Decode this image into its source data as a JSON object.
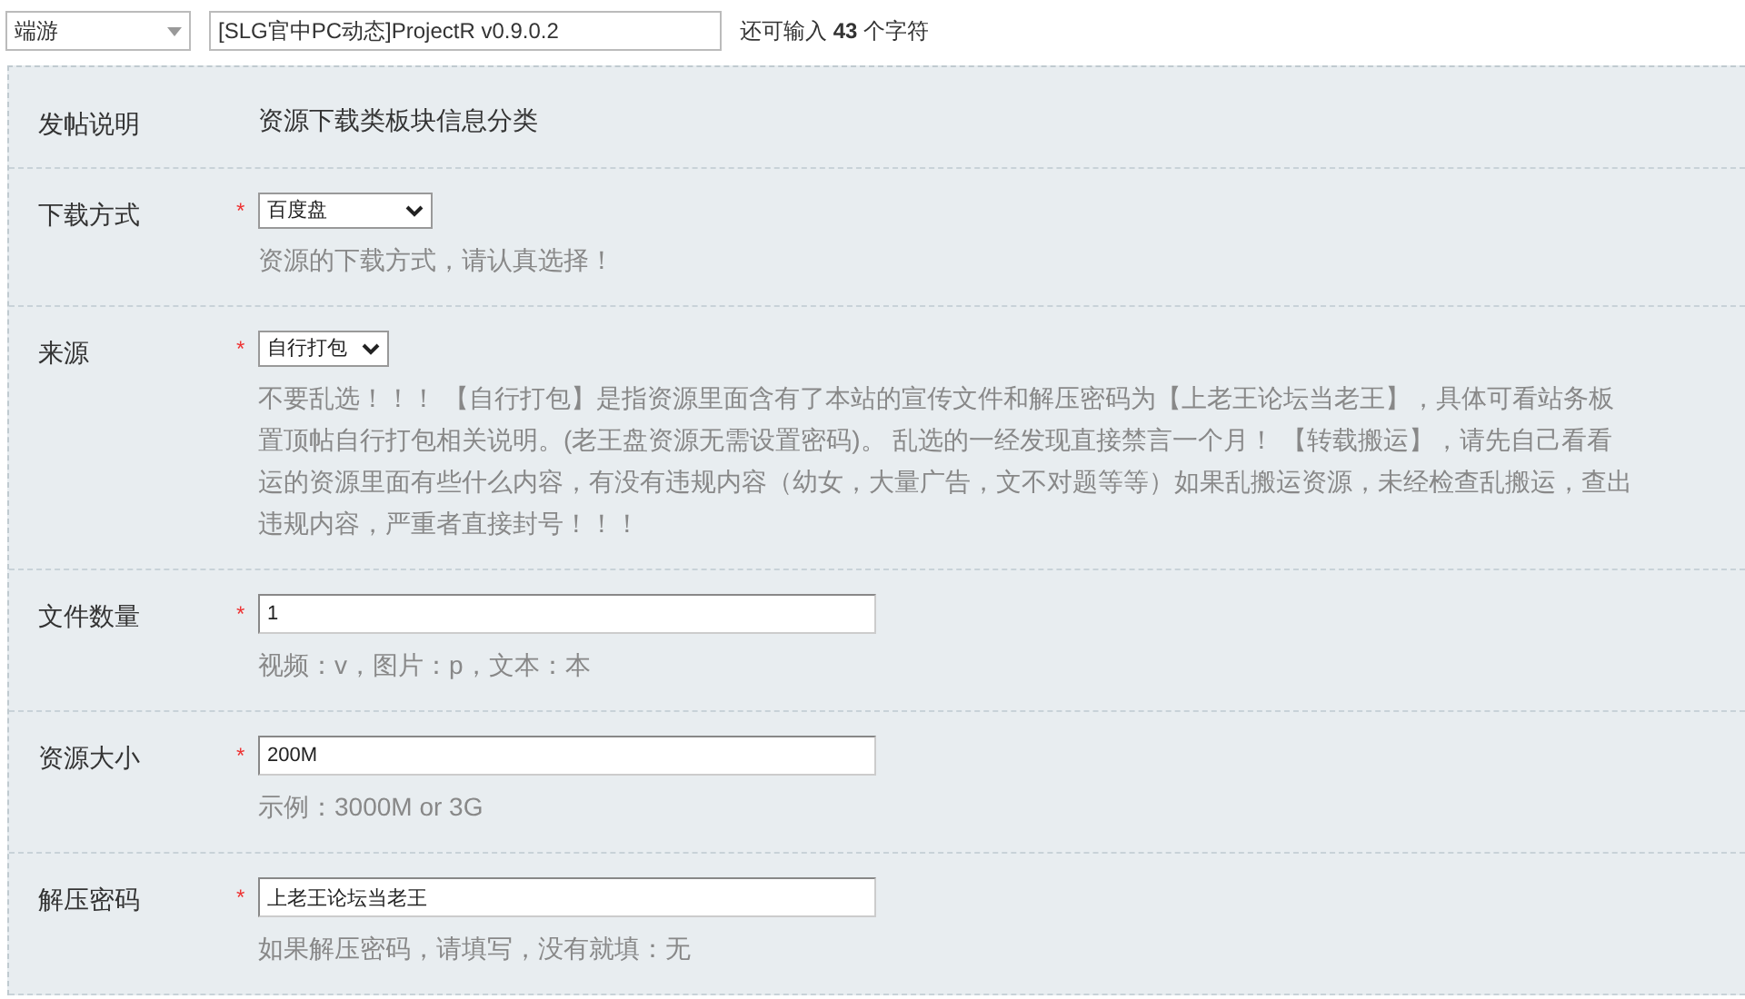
{
  "topbar": {
    "category": "端游",
    "title_value": "[SLG官中PC动态]ProjectR v0.9.0.2",
    "counter": "还可输入 **43** 个字符"
  },
  "rows": [
    {
      "kind": "info",
      "label": "发帖说明",
      "text": "资源下载类板块信息分类"
    },
    {
      "kind": "select",
      "label": "下载方式",
      "required_mark": "*",
      "value": "百度盘",
      "hint": [
        "资源的下载方式，请认真选择！"
      ]
    },
    {
      "kind": "select",
      "label": "来源",
      "required_mark": "*",
      "value": "自行打包",
      "hint": [
        "不要乱选！！！ 【自行打包】是指资源里面含有了本站的宣传文件和解压密码为【上老王论坛当老王】，具体可看站务板",
        "置顶帖自行打包相关说明。(老王盘资源无需设置密码)。 乱选的一经发现直接禁言一个月！ 【转载搬运】，请先自己看看",
        "运的资源里面有些什么内容，有没有违规内容（幼女，大量广告，文不对题等等）如果乱搬运资源，未经检查乱搬运，查出",
        "违规内容，严重者直接封号！！！"
      ]
    },
    {
      "kind": "input",
      "label": "文件数量",
      "required_mark": "*",
      "value": "1",
      "hint": [
        "视频：v，图片：p，文本：本"
      ]
    },
    {
      "kind": "input",
      "label": "资源大小",
      "required_mark": "*",
      "value": "200M",
      "hint": [
        "示例：3000M or 3G"
      ]
    },
    {
      "kind": "input",
      "label": "解压密码",
      "required_mark": "*",
      "value": "上老王论坛当老王",
      "hint": [
        "如果解压密码，请填写，没有就填：无"
      ]
    }
  ]
}
